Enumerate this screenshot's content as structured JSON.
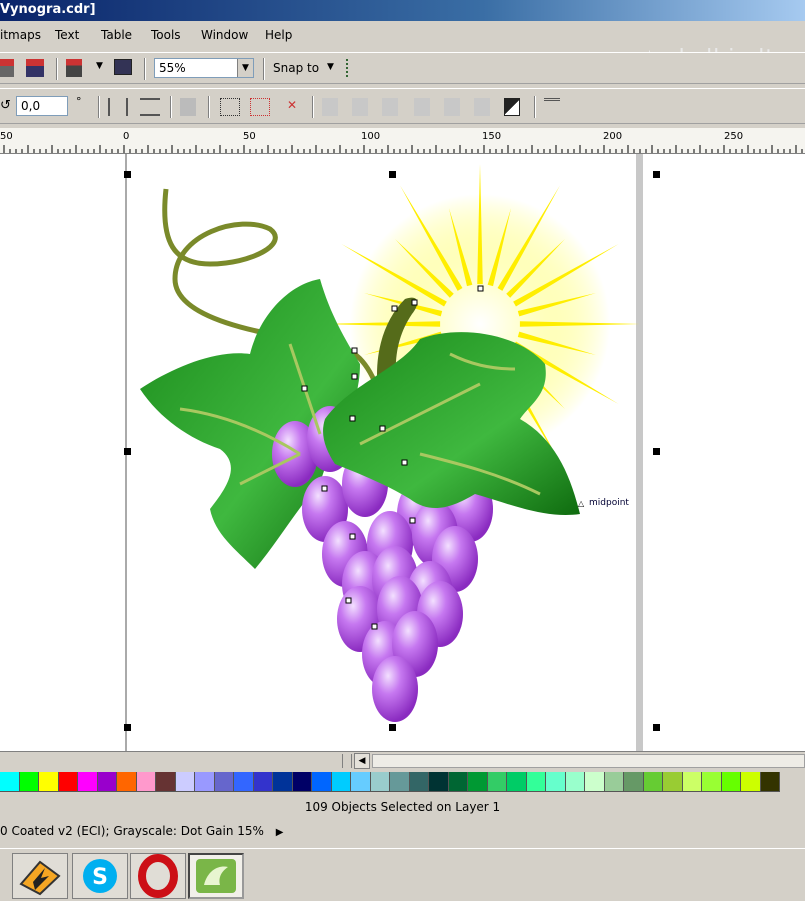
{
  "window": {
    "title": "Vynogra.cdr]"
  },
  "menu": [
    "itmaps",
    "Text",
    "Table",
    "Tools",
    "Window",
    "Help"
  ],
  "watermark": "skelbiu.lt",
  "toolbar1": {
    "zoom_value": "55%",
    "snap_label": "Snap to"
  },
  "toolbar2": {
    "rotation_value": "0,0",
    "degree_symbol": "°"
  },
  "ruler": {
    "ticks": [
      "50",
      "0",
      "50",
      "100",
      "150",
      "200",
      "250"
    ]
  },
  "canvas": {
    "midpoint_label": "midpoint"
  },
  "palette": [
    "#00ffff",
    "#00ff00",
    "#ffff00",
    "#ff0000",
    "#ff00ff",
    "#9900cc",
    "#ff6600",
    "#ff99cc",
    "#663333",
    "#ccccff",
    "#9999ff",
    "#6666cc",
    "#3366ff",
    "#3333cc",
    "#003399",
    "#000066",
    "#0066ff",
    "#00ccff",
    "#66ccff",
    "#99cccc",
    "#669999",
    "#336666",
    "#003333",
    "#006633",
    "#009933",
    "#33cc66",
    "#00cc66",
    "#33ff99",
    "#66ffcc",
    "#99ffcc",
    "#ccffcc",
    "#99cc99",
    "#669966",
    "#66cc33",
    "#99cc33",
    "#ccff66",
    "#99ff33",
    "#66ff00",
    "#ccff00",
    "#333300"
  ],
  "status": {
    "selection": "109 Objects Selected on Layer 1",
    "color_profile": "0 Coated v2 (ECI); Grayscale: Dot Gain 15%"
  },
  "taskbar": {
    "apps": [
      "winamp-icon",
      "skype-icon",
      "opera-icon",
      "coreldraw-icon"
    ]
  }
}
